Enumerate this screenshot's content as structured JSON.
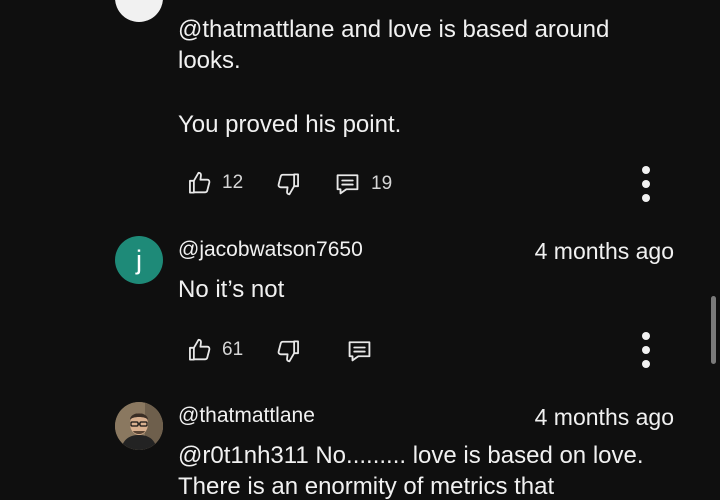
{
  "comments": [
    {
      "handle": "",
      "time": "",
      "line1": "@thatmattlane and love is based around",
      "line2": "looks.",
      "line3": "You proved his point.",
      "like_count": "12",
      "reply_count": "19"
    },
    {
      "avatar_letter": "j",
      "handle": "@jacobwatson7650",
      "time": "4 months ago",
      "line1": "No it’s not",
      "like_count": "61",
      "reply_count": ""
    },
    {
      "handle": "@thatmattlane",
      "time": "4 months ago",
      "line1": "@r0t1nh311 No......... love is based on love.",
      "line2": "There is an enormity of metrics that"
    }
  ],
  "icons": {
    "like": "thumbs-up-icon",
    "dislike": "thumbs-down-icon",
    "reply": "reply-comment-icon",
    "more": "more-vertical-icon"
  },
  "colors": {
    "background": "#0f0f0f",
    "text": "#f1f1f1",
    "avatar_j": "#1e8a78"
  }
}
